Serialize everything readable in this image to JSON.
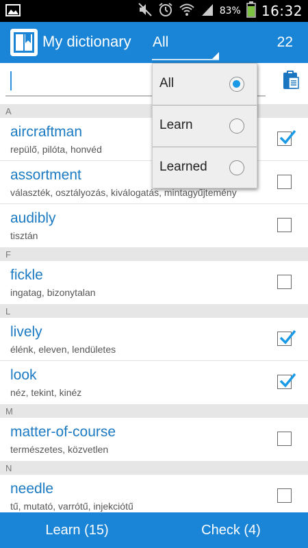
{
  "status_bar": {
    "battery_percent": "83%",
    "time": "16:32",
    "icons": [
      "image-icon",
      "mute-icon",
      "alarm-icon",
      "wifi-icon",
      "signal-icon",
      "battery-icon"
    ]
  },
  "app_bar": {
    "title": "My dictionary",
    "filter_value": "All",
    "word_count": "22",
    "icon": "dictionary-icon"
  },
  "search": {
    "value": "",
    "placeholder": "",
    "paste_icon": "clipboard-icon"
  },
  "colors": {
    "primary": "#1a85d6",
    "word_text": "#1b7ac2",
    "accent_check": "#1a9ae6"
  },
  "dictionary": {
    "sections": [
      {
        "letter": "A",
        "entries": [
          {
            "word": "aircraftman",
            "meaning": "repülő, pilóta, honvéd",
            "checked": true
          },
          {
            "word": "assortment",
            "meaning": "választék, osztályozás, kiválogatás, mintagyűjtemény",
            "checked": false
          },
          {
            "word": "audibly",
            "meaning": "tisztán",
            "checked": false
          }
        ]
      },
      {
        "letter": "F",
        "entries": [
          {
            "word": "fickle",
            "meaning": "ingatag, bizonytalan",
            "checked": false
          }
        ]
      },
      {
        "letter": "L",
        "entries": [
          {
            "word": "lively",
            "meaning": "élénk, eleven, lendületes",
            "checked": true
          },
          {
            "word": "look",
            "meaning": "néz, tekint, kinéz",
            "checked": true
          }
        ]
      },
      {
        "letter": "M",
        "entries": [
          {
            "word": "matter-of-course",
            "meaning": "természetes, közvetlen",
            "checked": false
          }
        ]
      },
      {
        "letter": "N",
        "entries": [
          {
            "word": "needle",
            "meaning": "tű, mutató, varrótű, injekciótű",
            "checked": false
          }
        ]
      }
    ]
  },
  "filter_dropdown": {
    "options": [
      {
        "label": "All",
        "selected": true
      },
      {
        "label": "Learn",
        "selected": false
      },
      {
        "label": "Learned",
        "selected": false
      }
    ]
  },
  "bottom_bar": {
    "learn_label": "Learn (15)",
    "check_label": "Check (4)"
  }
}
